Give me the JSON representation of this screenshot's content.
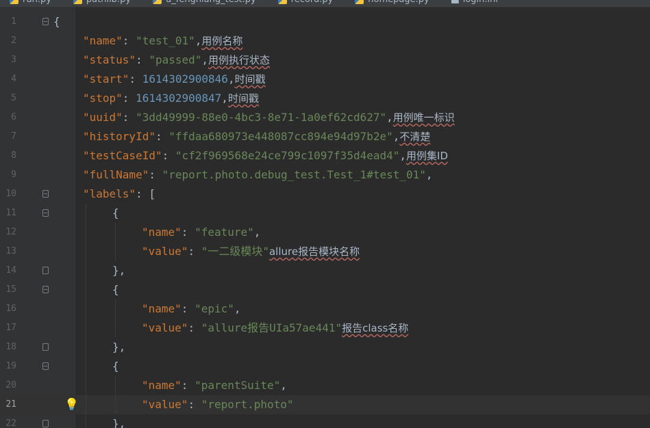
{
  "tabs": [
    {
      "label": "run.py",
      "icon": "python-file-icon"
    },
    {
      "label": "pathlib.py",
      "icon": "python-file-icon"
    },
    {
      "label": "u_fengniang_test.py",
      "icon": "python-file-icon"
    },
    {
      "label": "record.py",
      "icon": "python-file-icon"
    },
    {
      "label": "homepage.py",
      "icon": "python-file-icon"
    },
    {
      "label": "login.ini",
      "icon": "text-file-icon"
    }
  ],
  "lines": [
    {
      "n": "1",
      "segments": [
        {
          "t": "{",
          "c": "pun"
        }
      ],
      "indent": 0,
      "fold": "open"
    },
    {
      "n": "2",
      "segments": [
        {
          "t": "\"name\"",
          "c": "key"
        },
        {
          "t": ": ",
          "c": "pun"
        },
        {
          "t": "\"test_01\"",
          "c": "str"
        },
        {
          "t": ",",
          "c": "pun"
        },
        {
          "t": "用例名称",
          "c": "cmt"
        }
      ],
      "indent": 1
    },
    {
      "n": "3",
      "segments": [
        {
          "t": "\"status\"",
          "c": "key"
        },
        {
          "t": ": ",
          "c": "pun"
        },
        {
          "t": "\"passed\"",
          "c": "str"
        },
        {
          "t": ",",
          "c": "pun"
        },
        {
          "t": "用例执行状态",
          "c": "cmt"
        }
      ],
      "indent": 1
    },
    {
      "n": "4",
      "segments": [
        {
          "t": "\"start\"",
          "c": "key"
        },
        {
          "t": ": ",
          "c": "pun"
        },
        {
          "t": "1614302900846",
          "c": "num"
        },
        {
          "t": ",",
          "c": "pun"
        },
        {
          "t": "时间戳",
          "c": "cmt"
        }
      ],
      "indent": 1
    },
    {
      "n": "5",
      "segments": [
        {
          "t": "\"stop\"",
          "c": "key"
        },
        {
          "t": ": ",
          "c": "pun"
        },
        {
          "t": "1614302900847",
          "c": "num"
        },
        {
          "t": ",",
          "c": "pun"
        },
        {
          "t": "时间戳",
          "c": "cmt"
        }
      ],
      "indent": 1
    },
    {
      "n": "6",
      "segments": [
        {
          "t": "\"uuid\"",
          "c": "key"
        },
        {
          "t": ": ",
          "c": "pun"
        },
        {
          "t": "\"3dd49999-88e0-4bc3-8e71-1a0ef62cd627\"",
          "c": "str"
        },
        {
          "t": ",",
          "c": "pun"
        },
        {
          "t": "用例唯一标识",
          "c": "cmt"
        }
      ],
      "indent": 1
    },
    {
      "n": "7",
      "segments": [
        {
          "t": "\"historyId\"",
          "c": "key"
        },
        {
          "t": ": ",
          "c": "pun"
        },
        {
          "t": "\"ffdaa680973e448087cc894e94d97b2e\"",
          "c": "str"
        },
        {
          "t": ",",
          "c": "pun"
        },
        {
          "t": "不清楚",
          "c": "cmt"
        }
      ],
      "indent": 1
    },
    {
      "n": "8",
      "segments": [
        {
          "t": "\"testCaseId\"",
          "c": "key"
        },
        {
          "t": ": ",
          "c": "pun"
        },
        {
          "t": "\"cf2f969568e24ce799c1097f35d4ead4\"",
          "c": "str"
        },
        {
          "t": ",",
          "c": "pun"
        },
        {
          "t": "用例集ID",
          "c": "cmt"
        }
      ],
      "indent": 1
    },
    {
      "n": "9",
      "segments": [
        {
          "t": "\"fullName\"",
          "c": "key"
        },
        {
          "t": ": ",
          "c": "pun"
        },
        {
          "t": "\"report.photo.debug_test.Test_1#test_01\"",
          "c": "str"
        },
        {
          "t": ",",
          "c": "pun"
        }
      ],
      "indent": 1
    },
    {
      "n": "10",
      "segments": [
        {
          "t": "\"labels\"",
          "c": "key"
        },
        {
          "t": ": [",
          "c": "pun"
        }
      ],
      "indent": 1,
      "fold": "open"
    },
    {
      "n": "11",
      "segments": [
        {
          "t": "{",
          "c": "pun"
        }
      ],
      "indent": 2,
      "fold": "open"
    },
    {
      "n": "12",
      "segments": [
        {
          "t": "\"name\"",
          "c": "key"
        },
        {
          "t": ": ",
          "c": "pun"
        },
        {
          "t": "\"feature\"",
          "c": "str"
        },
        {
          "t": ",",
          "c": "pun"
        }
      ],
      "indent": 3
    },
    {
      "n": "13",
      "segments": [
        {
          "t": "\"value\"",
          "c": "key"
        },
        {
          "t": ": ",
          "c": "pun"
        },
        {
          "t": "\"一二级模块\"",
          "c": "str"
        },
        {
          "t": "allure报告模块名称",
          "c": "cmt"
        }
      ],
      "indent": 3
    },
    {
      "n": "14",
      "segments": [
        {
          "t": "},",
          "c": "pun"
        }
      ],
      "indent": 2,
      "fold": "close"
    },
    {
      "n": "15",
      "segments": [
        {
          "t": "{",
          "c": "pun"
        }
      ],
      "indent": 2,
      "fold": "open"
    },
    {
      "n": "16",
      "segments": [
        {
          "t": "\"name\"",
          "c": "key"
        },
        {
          "t": ": ",
          "c": "pun"
        },
        {
          "t": "\"epic\"",
          "c": "str"
        },
        {
          "t": ",",
          "c": "pun"
        }
      ],
      "indent": 3
    },
    {
      "n": "17",
      "segments": [
        {
          "t": "\"value\"",
          "c": "key"
        },
        {
          "t": ": ",
          "c": "pun"
        },
        {
          "t": "\"allure报告UIa57ae441\"",
          "c": "str"
        },
        {
          "t": "报告class名称",
          "c": "cmt"
        }
      ],
      "indent": 3
    },
    {
      "n": "18",
      "segments": [
        {
          "t": "},",
          "c": "pun"
        }
      ],
      "indent": 2,
      "fold": "close"
    },
    {
      "n": "19",
      "segments": [
        {
          "t": "{",
          "c": "pun"
        }
      ],
      "indent": 2,
      "fold": "open"
    },
    {
      "n": "20",
      "segments": [
        {
          "t": "\"name\"",
          "c": "key"
        },
        {
          "t": ": ",
          "c": "pun"
        },
        {
          "t": "\"parentSuite\"",
          "c": "str"
        },
        {
          "t": ",",
          "c": "pun"
        }
      ],
      "indent": 3
    },
    {
      "n": "21",
      "segments": [
        {
          "t": "\"value\"",
          "c": "key"
        },
        {
          "t": ": ",
          "c": "pun"
        },
        {
          "t": "\"report.photo\"",
          "c": "str"
        }
      ],
      "indent": 3,
      "current": true,
      "bulb": true
    },
    {
      "n": "22",
      "segments": [
        {
          "t": "},",
          "c": "pun"
        }
      ],
      "indent": 2,
      "fold": "close"
    }
  ],
  "colors": {
    "background": "#2b2b2b",
    "gutter": "#313335",
    "key": "#cc7832",
    "string": "#6a8759",
    "number": "#6897bb",
    "text": "#a9b7c6",
    "current_line": "#323232",
    "bulb": "#f3c13b"
  }
}
